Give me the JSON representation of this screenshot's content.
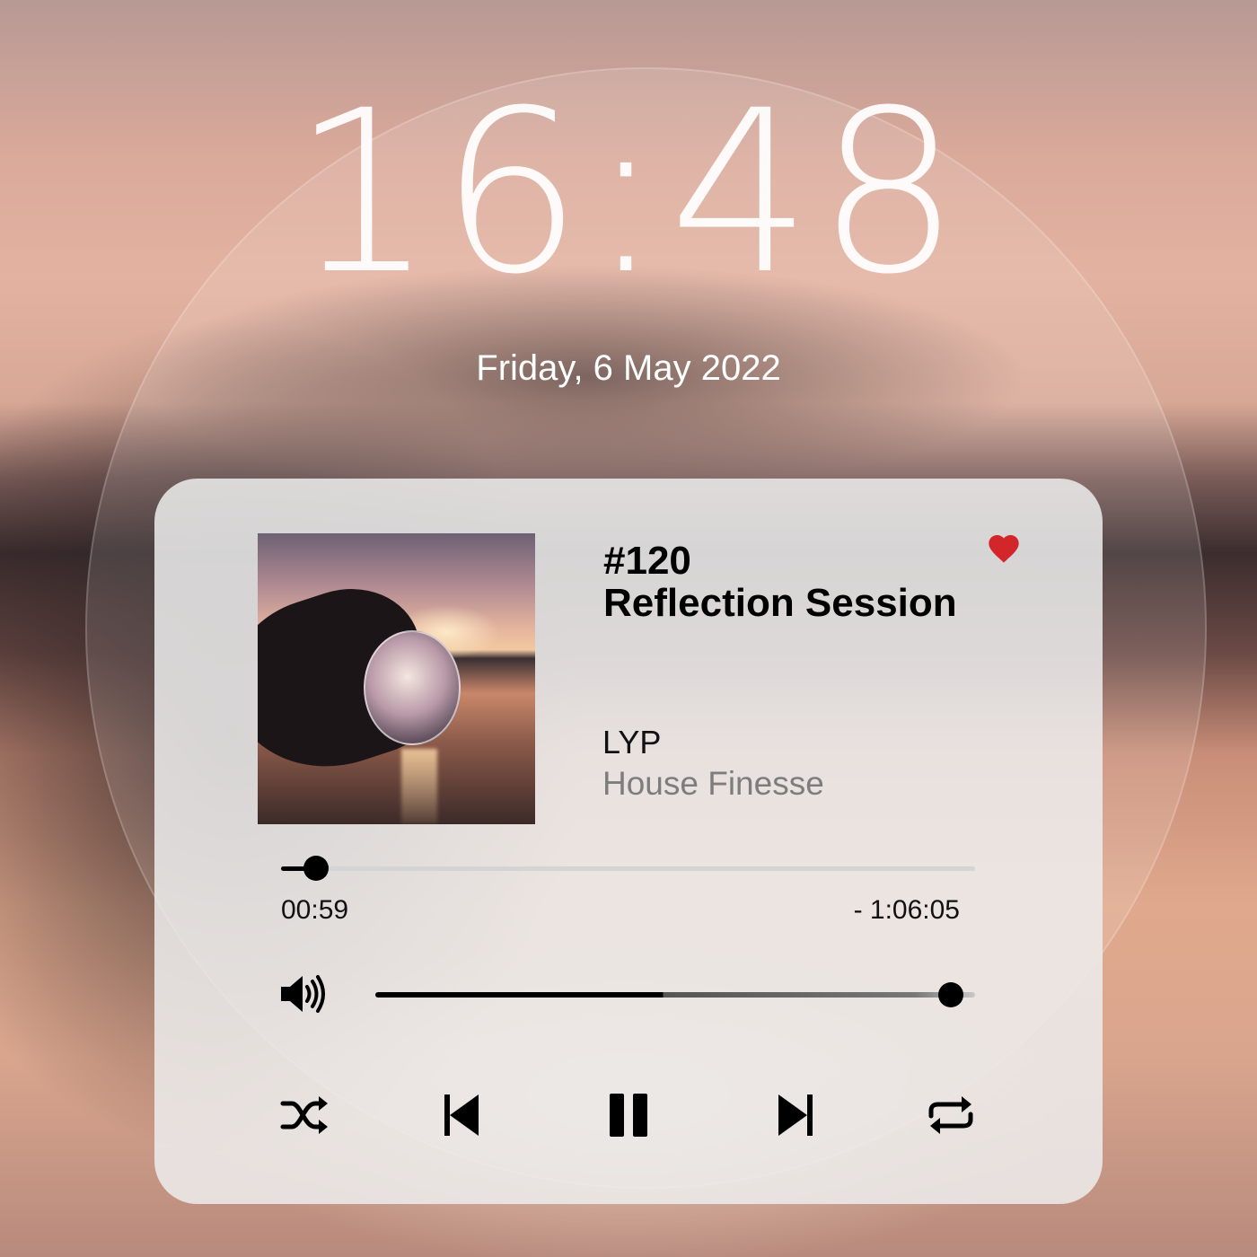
{
  "lockscreen": {
    "time": "16:48",
    "date": "Friday, 6 May 2022"
  },
  "player": {
    "episode_number": "#120",
    "title": "Reflection Session",
    "artist": "LYP",
    "album": "House Finesse",
    "favorite": true,
    "progress": {
      "elapsed": "00:59",
      "remaining": "- 1:06:05",
      "fraction": 0.05
    },
    "volume": {
      "level": 0.96
    },
    "controls": [
      "shuffle-icon",
      "previous-icon",
      "pause-icon",
      "next-icon",
      "repeat-icon"
    ],
    "colors": {
      "heart": "#d3262b",
      "accent": "#000000",
      "secondary_text": "#7d7d7d"
    }
  }
}
